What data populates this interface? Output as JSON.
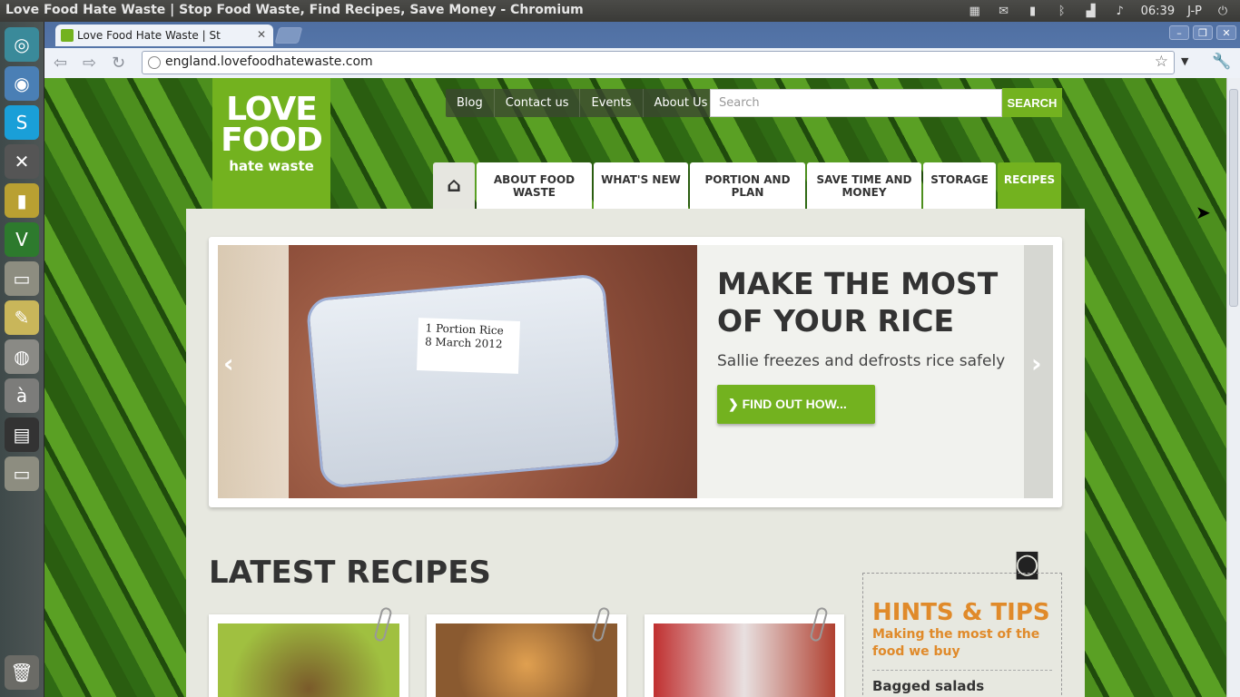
{
  "window_title": "Love Food Hate Waste | Stop Food Waste, Find Recipes, Save Money - Chromium",
  "tray": {
    "clock": "06:39",
    "user": "J-P"
  },
  "browser": {
    "tab_title": "Love Food Hate Waste | St",
    "url": "england.lovefoodhatewaste.com"
  },
  "site": {
    "logo": {
      "line1": "LOVE",
      "line2": "FOOD",
      "line3": "hate waste"
    },
    "utility_nav": [
      "Blog",
      "Contact us",
      "Events",
      "About Us"
    ],
    "search": {
      "placeholder": "Search",
      "button": "SEARCH"
    },
    "main_nav": [
      {
        "label": "ABOUT FOOD WASTE"
      },
      {
        "label": "WHAT'S NEW"
      },
      {
        "label": "PORTION AND PLAN"
      },
      {
        "label": "SAVE TIME AND MONEY"
      },
      {
        "label": "STORAGE"
      },
      {
        "label": "RECIPES"
      }
    ],
    "slide": {
      "heading": "MAKE THE MOST OF YOUR RICE",
      "subtitle": "Sallie freezes and defrosts rice safely",
      "cta": "FIND OUT HOW...",
      "label_text": "1 Portion Rice 8 March 2012"
    },
    "latest_heading": "LATEST RECIPES",
    "hints": {
      "title": "HINTS & TIPS",
      "subtitle": "Making the most of the food we buy",
      "item": "Bagged salads"
    }
  },
  "colors": {
    "brand_green": "#73b21f",
    "hints_orange": "#e08a2a"
  }
}
